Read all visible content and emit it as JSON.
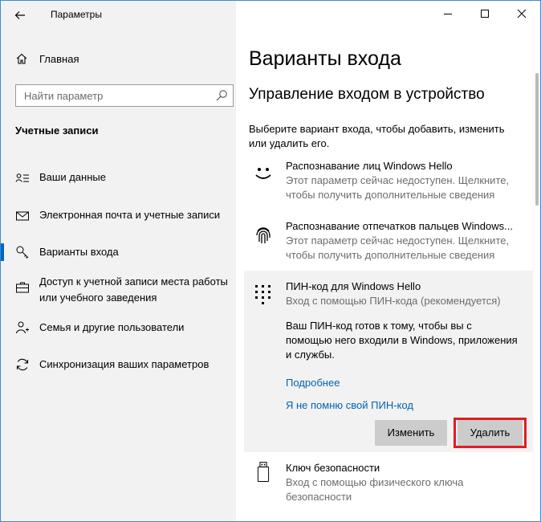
{
  "window": {
    "title": "Параметры"
  },
  "sidebar": {
    "home_label": "Главная",
    "search_placeholder": "Найти параметр",
    "section_title": "Учетные записи",
    "items": [
      {
        "label": "Ваши данные",
        "icon": "person-card-icon"
      },
      {
        "label": "Электронная почта и учетные записи",
        "icon": "mail-icon"
      },
      {
        "label": "Варианты входа",
        "icon": "key-icon",
        "active": true
      },
      {
        "label": "Доступ к учетной записи места работы или учебного заведения",
        "icon": "briefcase-icon"
      },
      {
        "label": "Семья и другие пользователи",
        "icon": "person-add-icon"
      },
      {
        "label": "Синхронизация ваших параметров",
        "icon": "sync-icon"
      }
    ]
  },
  "main": {
    "page_title": "Варианты входа",
    "subsection_title": "Управление входом в устройство",
    "intro": "Выберите вариант входа, чтобы добавить, изменить или удалить его.",
    "options": [
      {
        "title": "Распознавание лиц Windows Hello",
        "description": "Этот параметр сейчас недоступен. Щелкните, чтобы получить дополнительные сведения",
        "icon": "face-icon"
      },
      {
        "title": "Распознавание отпечатков пальцев Windows...",
        "description": "Этот параметр сейчас недоступен. Щелкните, чтобы получить дополнительные сведения",
        "icon": "fingerprint-icon"
      },
      {
        "title": "ПИН-код для Windows Hello",
        "description": "Вход с помощью ПИН-кода (рекомендуется)",
        "icon": "pin-keypad-icon"
      },
      {
        "title": "Ключ безопасности",
        "description": "Вход с помощью физического ключа безопасности",
        "icon": "usb-key-icon"
      }
    ],
    "pin_detail": {
      "text": "Ваш ПИН-код готов к тому, чтобы вы с помощью него входили в Windows, приложения и службы.",
      "learn_more": "Подробнее",
      "forgot_pin": "Я не помню свой ПИН-код",
      "change_label": "Изменить",
      "delete_label": "Удалить"
    }
  },
  "colors": {
    "accent": "#0067c0",
    "link": "#0063b1",
    "highlight_border": "#e21b23",
    "sidebar_bg": "#f2f2f2"
  }
}
